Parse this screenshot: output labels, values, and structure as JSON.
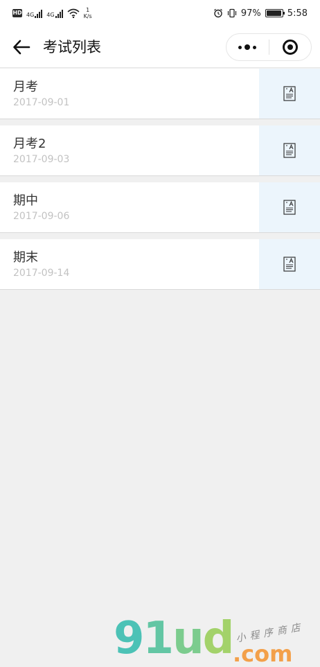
{
  "status_bar": {
    "hd": "HD",
    "net1": "4G",
    "net2": "4G",
    "speed_value": "1",
    "speed_unit": "K/s",
    "battery_percent": "97%",
    "battery_level": 0.97,
    "time": "5:58"
  },
  "nav": {
    "title": "考试列表"
  },
  "exams": [
    {
      "name": "月考",
      "date": "2017-09-01"
    },
    {
      "name": "月考2",
      "date": "2017-09-03"
    },
    {
      "name": "期中",
      "date": "2017-09-06"
    },
    {
      "name": "期末",
      "date": "2017-09-14"
    }
  ],
  "watermark": {
    "logo": "91ud",
    "domain": ".com",
    "tagline": "小程序商店"
  },
  "colors": {
    "action_bg": "#ecf5fc",
    "page_bg": "#f0f0f0",
    "date_text": "#c2c2c2"
  }
}
